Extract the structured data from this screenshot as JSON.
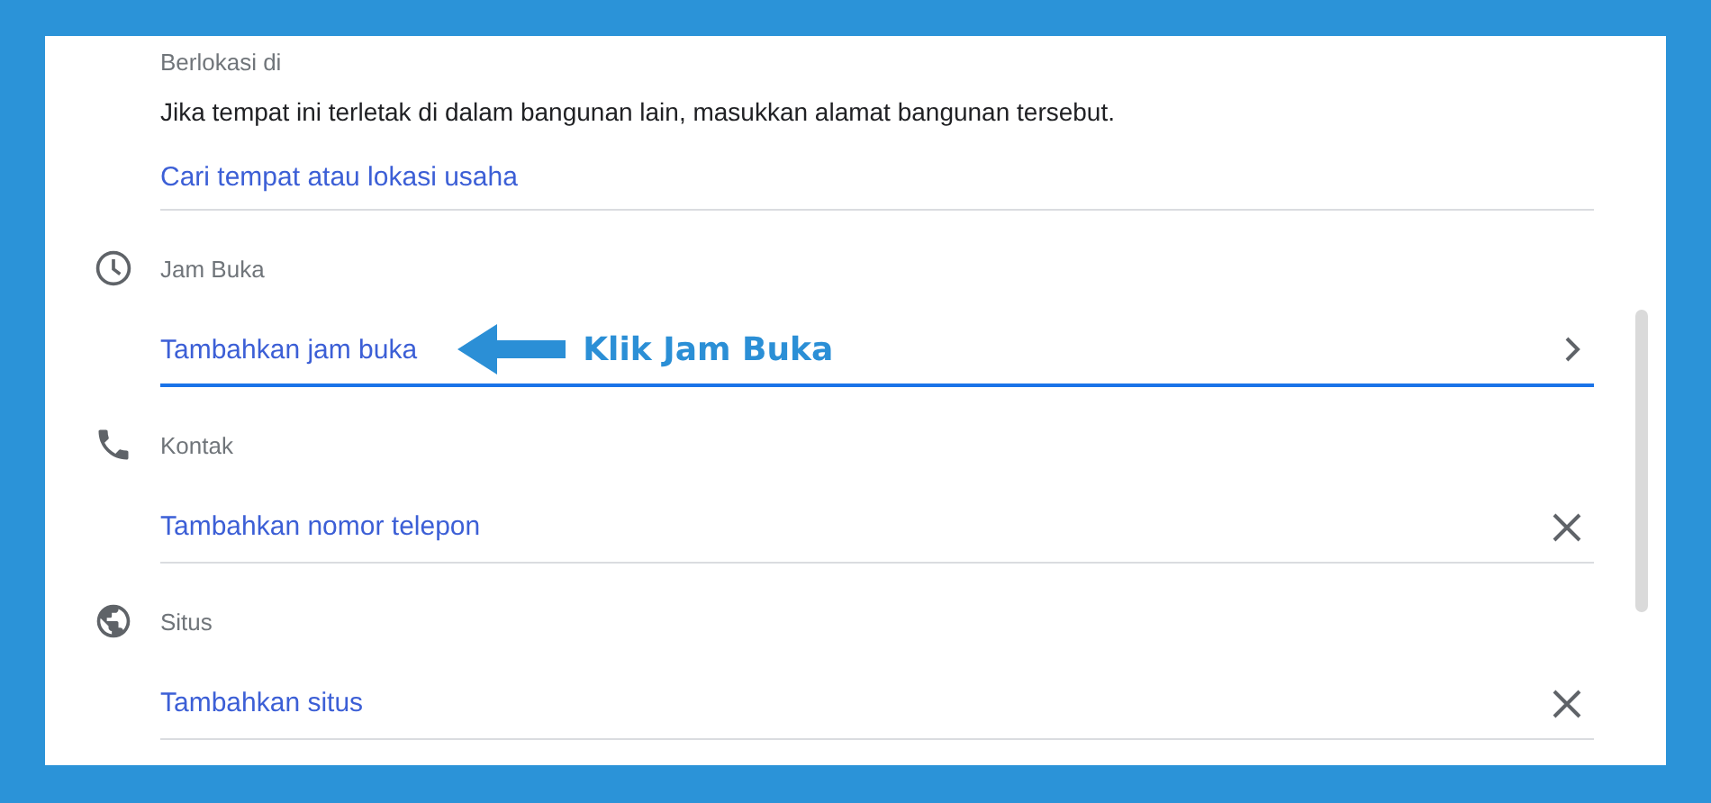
{
  "sections": [
    {
      "kind": "address",
      "label": "Berlokasi di",
      "description": "Jika tempat ini terletak di dalam bangunan lain, masukkan alamat bangunan tersebut.",
      "action": "Cari tempat atau lokasi usaha",
      "focused": false
    },
    {
      "kind": "hours",
      "label": "Jam Buka",
      "action": "Tambahkan jam buka",
      "focused": true
    },
    {
      "kind": "phone",
      "label": "Kontak",
      "action": "Tambahkan nomor telepon",
      "focused": false
    },
    {
      "kind": "website",
      "label": "Situs",
      "action": "Tambahkan situs",
      "focused": false
    }
  ],
  "annotation": {
    "text": "Klik Jam Buka"
  }
}
